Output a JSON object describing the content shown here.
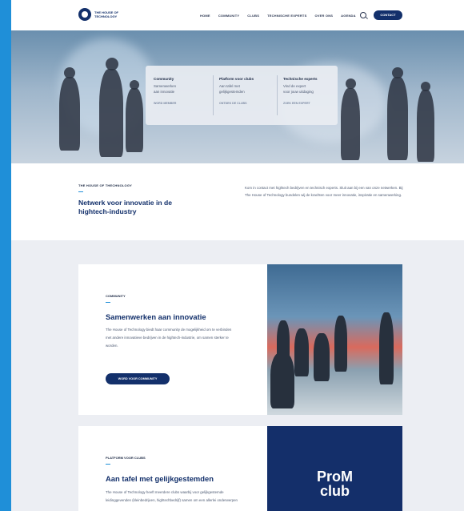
{
  "header": {
    "logo_text": "THE HOUSE OF TECHNOLOGY",
    "nav": [
      "HOME",
      "COMMUNITY",
      "CLUBS",
      "TECHNISCHE EXPERTS",
      "OVER ONS",
      "AGENDA"
    ],
    "contact_label": "CONTACT"
  },
  "hero_card": {
    "columns": [
      {
        "title": "Community",
        "lines": [
          "Samenwerken",
          "aan innovatie"
        ],
        "link": "WORD MEMBER"
      },
      {
        "title": "Platform voor clubs",
        "lines": [
          "Aan tafel met",
          "gelijkgestemden"
        ],
        "link": "ONTDEK DE CLUBS"
      },
      {
        "title": "Technische experts",
        "lines": [
          "Vind de expert",
          "voor jouw uitdaging"
        ],
        "link": "ZOEK EEN EXPERT"
      }
    ]
  },
  "intro": {
    "eyebrow": "THE HOUSE OF THECHNOLOGY",
    "title": "Netwerk voor innovatie in de hightech-industry",
    "text": "Kom in contact met hightech bedrijven en technisch experts. Sluit aan bij een van onze netwerken. Bij The House of Technology bundelen wij de krachten voor meer innovatie, inspiratie en samenwerking."
  },
  "community": {
    "eyebrow": "COMMUNITY",
    "title": "Samenwerken aan innovatie",
    "text": "The House of Technology biedt haar community de mogelijkheid om te verbinden met andere innovatieve bedrijven in de hightech-industrie, om samen sterker te worden.",
    "button": "WORD VOOR COMMUNITY"
  },
  "clubs": {
    "eyebrow": "PLATFORM VOOR CLUBS",
    "title": "Aan tafel met gelijkgestemden",
    "text": "The House of Technology heeft meerdere clubs waarbij voor gelijkgestemde leidinggevenden (kleinbedrijven, hightechbedrijf) samen om een allerlei onderwerpen",
    "logo_line1": "ProM",
    "logo_line2": "club"
  }
}
